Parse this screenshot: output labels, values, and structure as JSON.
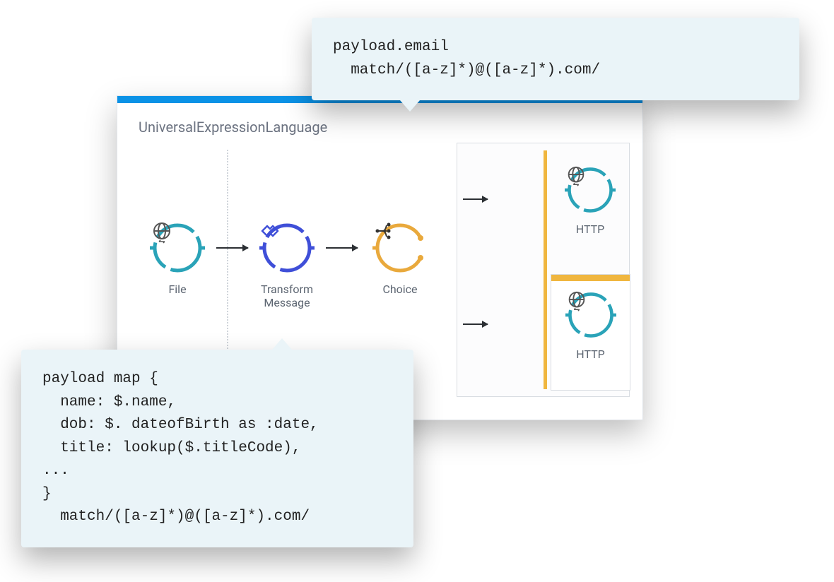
{
  "canvas": {
    "title": "UniversalExpressionLanguage"
  },
  "nodes": {
    "file": {
      "label": "File"
    },
    "transform": {
      "label": "Transform\nMessage"
    },
    "choice": {
      "label": "Choice"
    },
    "http1": {
      "label": "HTTP"
    },
    "http2": {
      "label": "HTTP"
    }
  },
  "callouts": {
    "top": "payload.email\n  match/([a-z]*)@([a-z]*).com/",
    "bottom": "payload map {\n  name: $.name,\n  dob: $. dateofBirth as :date,\n  title: lookup($.titleCode),\n...\n}\n  match/([a-z]*)@([a-z]*).com/"
  },
  "colors": {
    "teal": "#2aa3b8",
    "indigo": "#3f4fd8",
    "amber": "#e9a93c",
    "headerBlue": "#0b92e6"
  }
}
